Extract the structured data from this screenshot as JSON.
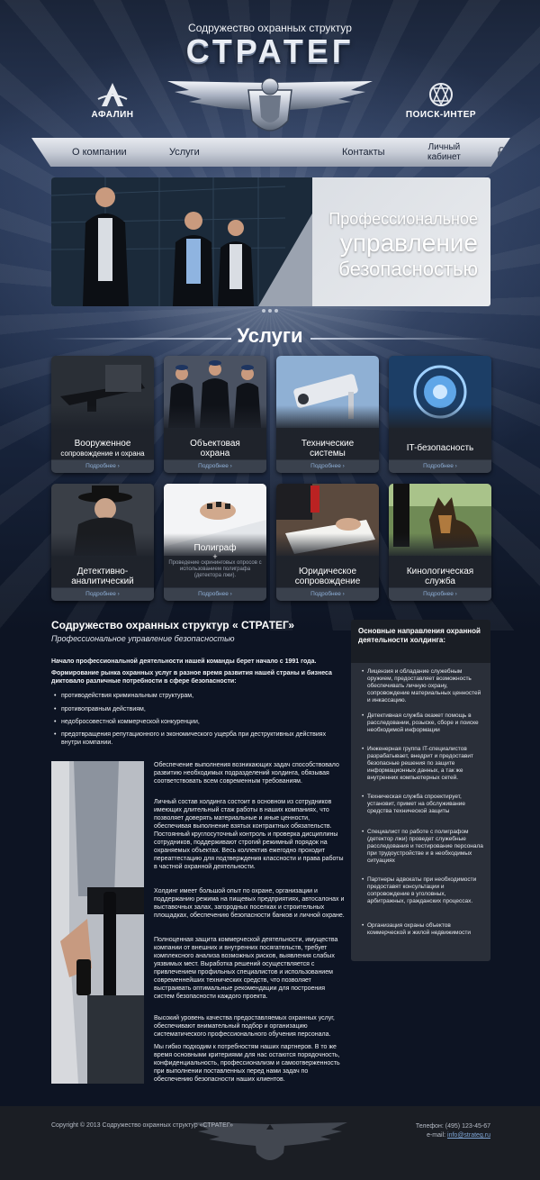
{
  "header": {
    "subtitle": "Содружество охранных структур",
    "title": "СТРАТЕГ",
    "partner_left": "АФАЛИН",
    "partner_right": "ПОИСК-ИНТЕР"
  },
  "nav": {
    "items": [
      "О компании",
      "Услуги",
      "Контакты"
    ],
    "cabinet_line1": "Личный",
    "cabinet_line2": "кабинет"
  },
  "hero": {
    "line1": "Профессиональное",
    "line2": "управление",
    "line3": "безопасностью"
  },
  "services": {
    "title": "Услуги",
    "more": "Подробнее ›",
    "cards": [
      {
        "title": "Вооруженное",
        "subtitle": "сопровождение и охрана"
      },
      {
        "title": "Объектовая",
        "subtitle": "охрана"
      },
      {
        "title": "Технические",
        "subtitle": "системы"
      },
      {
        "title": "IT-безопасность",
        "subtitle": ""
      },
      {
        "title": "Детективно-",
        "subtitle": "аналитический"
      },
      {
        "title": "Полиграф",
        "subtitle": "Проведение скрининговых опросов с использованием полиграфа (детектора лжи)."
      },
      {
        "title": "Юридическое",
        "subtitle": "сопровождение"
      },
      {
        "title": "Кинологическая",
        "subtitle": "служба"
      }
    ]
  },
  "content": {
    "title": "Содружество охранных структур « СТРАТЕГ»",
    "subtitle": "Профессиональное управление безопасностью",
    "p1": "Начало  профессиональной деятельности  нашей команды берет начало с 1991 года.",
    "p2": "Формирование рынка охранных услуг в разное время развития нашей страны и бизнеса диктовало различные потребности в сфере безопасности:",
    "bullets": [
      "противодействия криминальным структурам,",
      "противоправным действиям,",
      "недобросовестной коммерческой конкуренции,",
      "предотвращения репутационного и экономического ущерба при деструктивных действиях внутри компании."
    ],
    "article": [
      "Обеспечение выполнения возникающих задач способствовало развитию необходимых подразделений холдинга, обязывая соответствовать всем современным требованиям.",
      "Личный состав холдинга состоит в основном из сотрудников имеющих длительный стаж работы в наших компаниях, что позволяет  доверять материальные и иные ценности, обеспечивая выполнение взятых контрактных обязательств.  Постоянный  круглосуточный контроль и проверка дисциплины сотрудников, поддерживают строгий режимный порядок на охраняемых объектах. Весь коллектив ежегодно проходит переаттестацию для подтверждения классности и права работы в частной охранной деятельности.",
      "Холдинг имеет большой опыт по охране, организации и поддержанию режима на пищевых предприятиях, автосалонах и выставочных залах, загородных поселках и строительных площадках,  обеспечению безопасности банков и личной охране.",
      "Полноценная защита коммерческой деятельности, имущества компании от внешних и внутренних посягательств, требует комплексного анализа  возможных рисков, выявления слабых уязвимых мест. Выработка решений осуществляется с привлечением профильных специалистов и использованием современнейших технических средств, что позволяет выстраивать оптимальные рекомендации для построения систем безопасности каждого проекта.",
      "Высокий уровень качества предоставляемых охранных услуг, обеспечивают внимательный подбор и организацию систематического профессионального обучения персонала.",
      "Мы гибко подходим к потребностям наших партнеров. В то же время основными критериями для нас остаются порядочность, конфиденциальность, профессионализм и самоотверженность при выполнении поставленных перед нами задач по обеспечению безопасности наших клиентов."
    ]
  },
  "sidebar": {
    "title": "Основные направления охранной деятельности холдинга:",
    "items": [
      "Лицензия и обладание служебным оружием, предоставляет возможность обеспечивать личную охрану, сопровождение материальных ценностей и инкассацию.",
      "Детективная служба окажет помощь в расследовании, розыске, сборе и поиске необходимой информации",
      "Инженерная группа IT-специалистов разрабатывает, внедрит и предоставит безопасные решения по защите информационных  данных, а так же внутренних компьютерных сетей.",
      "Техническая служба спроектирует, установит, примет на обслуживание средства технической защиты",
      "Специалист по работе с полиграфом (детектор лжи) проведет служебные расследования и тестирование персонала при трудоустройстве и в необходимых ситуациях",
      "Партнеры адвокаты при необходимости предоставят консультации и сопровождение в уголовных, арбитражных, гражданских процессах.",
      "Организация охраны объектов коммерческой и жилой недвижимости"
    ]
  },
  "footer": {
    "copyright": "Copyright © 2013 Содружество охранных структур «СТРАТЕГ»",
    "phone": "Телефон: (495) 123-45-67",
    "email_label": "e-mail: ",
    "email": "info@strateg.ru"
  },
  "colors": {
    "background": "#0d1423",
    "nav": "#c8cdd7",
    "card": "#2b313c",
    "link": "#8fb0d8"
  }
}
